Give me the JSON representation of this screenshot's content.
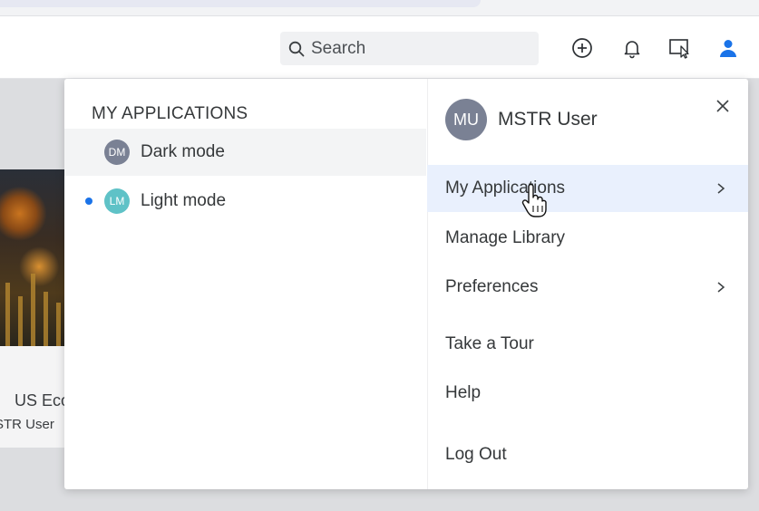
{
  "header": {
    "search": {
      "label": "Search",
      "icon": "search-icon"
    },
    "icons": [
      "add-circle-icon",
      "bell-icon",
      "present-mode-icon",
      "user-icon"
    ],
    "accent_color": "#1a73e8"
  },
  "background": {
    "card_title": "US Eco",
    "card_owner": "STR User"
  },
  "apps_panel": {
    "heading": "MY APPLICATIONS",
    "apps": [
      {
        "initials": "DM",
        "label": "Dark mode",
        "avatar_color": "#7a8194",
        "hovered": true,
        "current": false
      },
      {
        "initials": "LM",
        "label": "Light mode",
        "avatar_color": "#5fc2c7",
        "hovered": false,
        "current": true
      }
    ]
  },
  "account_menu": {
    "user": {
      "initials": "MU",
      "name": "MSTR User"
    },
    "items": [
      {
        "label": "My Applications",
        "has_submenu": true,
        "active": true
      },
      {
        "label": "Manage Library",
        "has_submenu": false,
        "active": false
      },
      {
        "label": "Preferences",
        "has_submenu": true,
        "active": false
      },
      {
        "label": "Take a Tour",
        "has_submenu": false,
        "active": false
      },
      {
        "label": "Help",
        "has_submenu": false,
        "active": false
      },
      {
        "label": "Log Out",
        "has_submenu": false,
        "active": false
      }
    ]
  }
}
